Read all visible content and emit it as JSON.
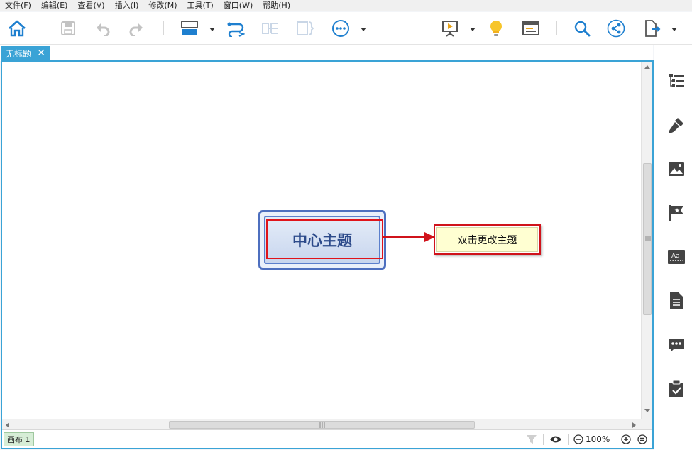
{
  "menubar": {
    "items": [
      "文件(F)",
      "编辑(E)",
      "查看(V)",
      "插入(I)",
      "修改(M)",
      "工具(T)",
      "窗口(W)",
      "帮助(H)"
    ]
  },
  "toolbar": {
    "icons": [
      "home-icon",
      "save-icon",
      "undo-icon",
      "redo-icon",
      "theme-icon",
      "relationship-icon",
      "summary-icon",
      "boundary-icon",
      "more-icon",
      "presentation-icon",
      "idea-icon",
      "outline-view-icon",
      "search-icon",
      "share-icon",
      "export-icon"
    ]
  },
  "tabs": {
    "document": "无标题",
    "close": "✕"
  },
  "mindmap": {
    "central_topic": "中心主题",
    "sub_topic": "双击更改主题"
  },
  "statusbar": {
    "sheet": "画布 1",
    "zoom": "100%"
  },
  "sidepanel": {
    "icons": [
      "outline-icon",
      "format-brush-icon",
      "image-icon",
      "marker-flag-icon",
      "text-style-icon",
      "notes-icon",
      "comment-icon",
      "task-icon"
    ]
  },
  "colors": {
    "accent": "#3aa3d6",
    "toolbar_icon": "#1e7fcf",
    "central_border": "#4d6fbf",
    "selection_red": "#e0141b",
    "subtopic_fill": "#ffffd2"
  }
}
